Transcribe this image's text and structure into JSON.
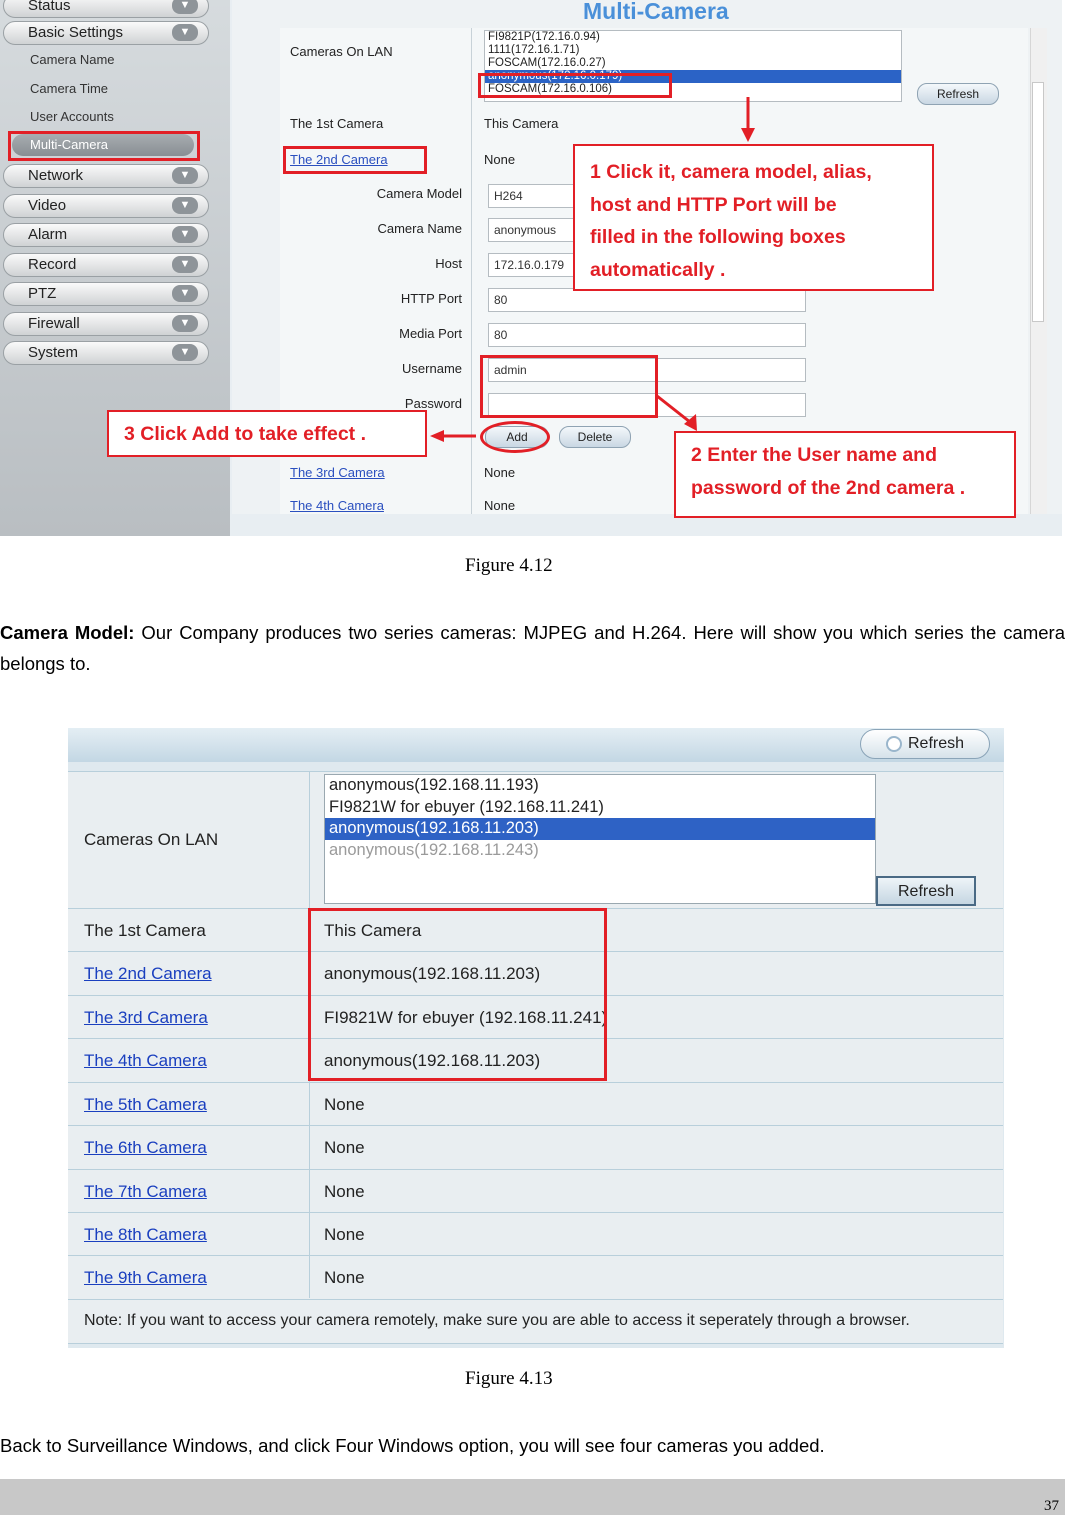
{
  "figure1": {
    "sidebar": {
      "menu": [
        "Status",
        "Basic Settings",
        "Network",
        "Video",
        "Alarm",
        "Record",
        "PTZ",
        "Firewall",
        "System"
      ],
      "sub_items": [
        "Camera Name",
        "Camera Time",
        "User Accounts"
      ],
      "active_sub": "Multi-Camera"
    },
    "title": "Multi-Camera",
    "cameras_on_lan_label": "Cameras On LAN",
    "lan_list": [
      "FI9821P(172.16.0.94)",
      "1111(172.16.1.71)",
      "FOSCAM(172.16.0.27)",
      "anonymous(172.16.0.179)",
      "FOSCAM(172.16.0.106)"
    ],
    "refresh_label": "Refresh",
    "first_camera_label": "The 1st Camera",
    "first_camera_value": "This Camera",
    "second_camera_label": "The 2nd Camera",
    "second_camera_value": "None",
    "fields": {
      "camera_model_label": "Camera Model",
      "camera_model_value": "H264",
      "camera_name_label": "Camera Name",
      "camera_name_value": "anonymous",
      "host_label": "Host",
      "host_value": "172.16.0.179",
      "http_port_label": "HTTP Port",
      "http_port_value": "80",
      "media_port_label": "Media Port",
      "media_port_value": "80",
      "username_label": "Username",
      "username_value": "admin",
      "password_label": "Password",
      "password_value": ""
    },
    "add_label": "Add",
    "delete_label": "Delete",
    "third_camera_label": "The 3rd Camera",
    "third_camera_value": "None",
    "fourth_camera_label": "The 4th Camera",
    "fourth_camera_value": "None",
    "callout1": [
      "1 Click it, camera model, alias,",
      "host and HTTP Port will be",
      "filled in the following boxes",
      "automatically ."
    ],
    "callout2": [
      "2 Enter the User name and",
      "password of the 2nd camera ."
    ],
    "callout3": "3 Click Add to take effect .",
    "caption": "Figure 4.12"
  },
  "paragraph1": {
    "bold": "Camera Model:",
    "text": " Our Company produces two series cameras: MJPEG and H.264. Here will show you which series the camera belongs to."
  },
  "figure2": {
    "refresh_label": "Refresh",
    "cameras_on_lan_label": "Cameras On LAN",
    "lan_list": [
      "anonymous(192.168.11.193)",
      "FI9821W for ebuyer (192.168.11.241)",
      "anonymous(192.168.11.203)",
      "anonymous(192.168.11.243)"
    ],
    "rows": [
      {
        "label": "The 1st Camera",
        "value": "This Camera"
      },
      {
        "label": "The 2nd Camera",
        "value": "anonymous(192.168.11.203)"
      },
      {
        "label": "The 3rd Camera",
        "value": "FI9821W for ebuyer (192.168.11.241)"
      },
      {
        "label": "The 4th Camera",
        "value": "anonymous(192.168.11.203)"
      },
      {
        "label": "The 5th Camera",
        "value": "None"
      },
      {
        "label": "The 6th Camera",
        "value": "None"
      },
      {
        "label": "The 7th Camera",
        "value": "None"
      },
      {
        "label": "The 8th Camera",
        "value": "None"
      },
      {
        "label": "The 9th Camera",
        "value": "None"
      }
    ],
    "note": "Note: If you want to access your camera remotely, make sure you are able to access it seperately through a browser.",
    "caption": "Figure 4.13"
  },
  "paragraph2": "Back to Surveillance Windows, and click Four Windows option, you will see four cameras you added.",
  "page_number": "37"
}
